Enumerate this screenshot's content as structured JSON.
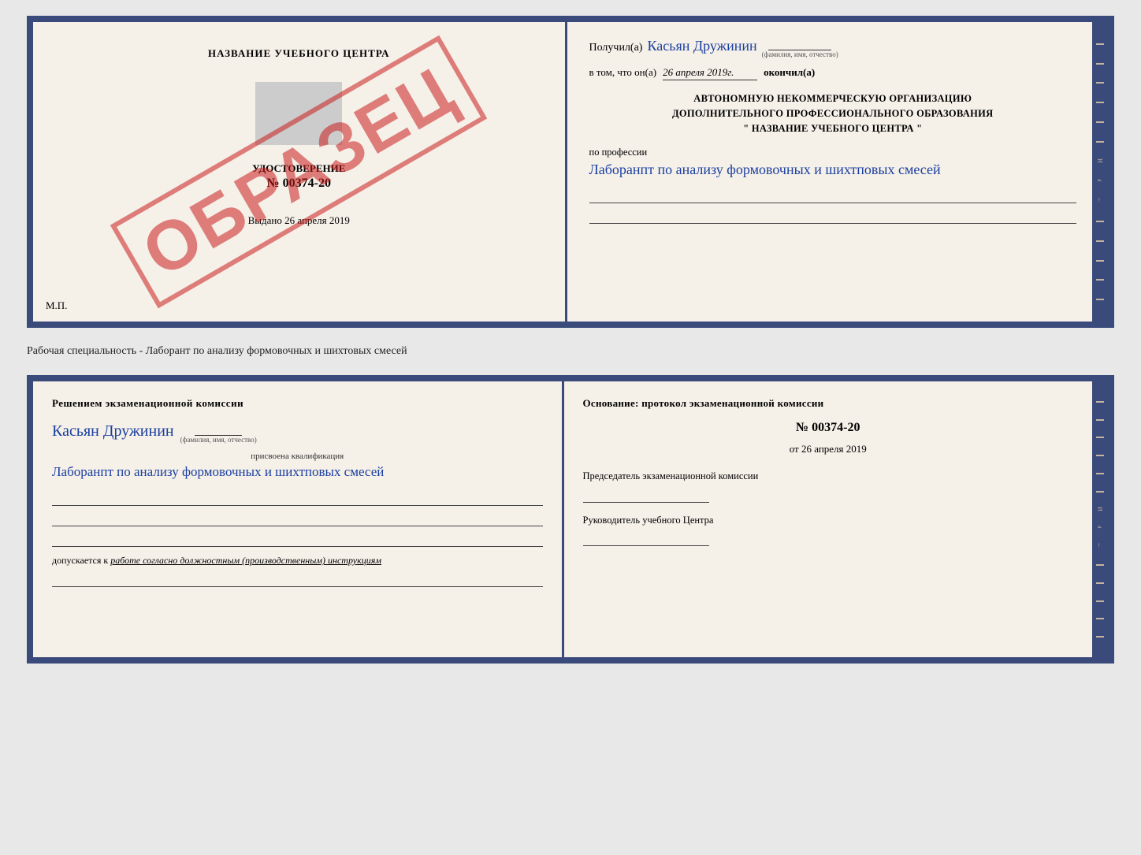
{
  "top_card": {
    "left": {
      "title": "НАЗВАНИЕ УЧЕБНОГО ЦЕНТРА",
      "udost_label": "УДОСТОВЕРЕНИЕ",
      "num_prefix": "№",
      "num": "00374-20",
      "vydano_label": "Выдано",
      "vydano_date": "26 апреля 2019",
      "mp": "М.П.",
      "stamp": "ОБРАЗЕЦ"
    },
    "right": {
      "poluchil": "Получил(а)",
      "name": "Касьян Дружинин",
      "name_label": "(фамилия, имя, отчество)",
      "vtom": "в том, что он(а)",
      "date": "26 апреля 2019г.",
      "okonchill": "окончил(а)",
      "org_line1": "АВТОНОМНУЮ НЕКОММЕРЧЕСКУЮ ОРГАНИЗАЦИЮ",
      "org_line2": "ДОПОЛНИТЕЛЬНОГО ПРОФЕССИОНАЛЬНОГО ОБРАЗОВАНИЯ",
      "org_name": "\"  НАЗВАНИЕ УЧЕБНОГО ЦЕНТРА  \"",
      "po_prof": "по профессии",
      "profession_hand": "Лаборанпт по анализу формовочных и шихтповых смесей"
    }
  },
  "middle": {
    "text": "Рабочая специальность - Лаборант по анализу формовочных и шихтовых смесей"
  },
  "bottom_card": {
    "left": {
      "resheniem": "Решением  экзаменационной  комиссии",
      "name": "Касьян  Дружинин",
      "name_label": "(фамилия, имя, отчество)",
      "prisvoyena": "присвоена квалификация",
      "qualification_hand": "Лаборанпт по анализу формовочных и шихтповых смесей",
      "dopusk_label": "допускается к",
      "dopusk_text": "работе согласно должностным (производственным) инструкциям"
    },
    "right": {
      "osnov": "Основание: протокол экзаменационной  комиссии",
      "num_prefix": "№",
      "num": "00374-20",
      "ot_prefix": "от",
      "ot_date": "26 апреля 2019",
      "predsedatel_label": "Председатель экзаменационной комиссии",
      "rukovoditel_label": "Руководитель учебного Центра"
    }
  }
}
